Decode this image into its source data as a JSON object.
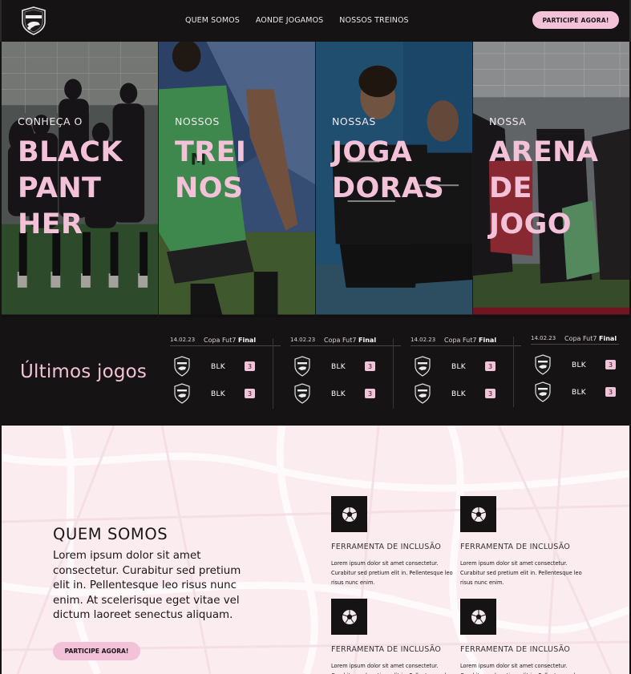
{
  "header": {
    "logo_text": "PANTHER",
    "nav": [
      "QUEM SOMOS",
      "AONDE JOGAMOS",
      "NOSSOS TREINOS"
    ],
    "cta_label": "PARTICIPE AGORA!"
  },
  "hero": {
    "panels": [
      {
        "subtitle": "CONHEÇA O",
        "title_lines": [
          "BLACK",
          "PANT",
          "HER"
        ]
      },
      {
        "subtitle": "NOSSOS",
        "title_lines": [
          "TREI",
          "NOS"
        ]
      },
      {
        "subtitle": "NOSSAS",
        "title_lines": [
          "JOGA",
          "DORAS"
        ]
      },
      {
        "subtitle": "NOSSA",
        "title_lines": [
          "ARENA",
          "DE",
          "JOGO"
        ]
      }
    ]
  },
  "games": {
    "title": "Últimos jogos",
    "cards": [
      {
        "date": "14.02.23",
        "competition": "Copa Fut7",
        "stage": "Final",
        "rows": [
          {
            "team": "BLK",
            "score": "3"
          },
          {
            "team": "BLK",
            "score": "3"
          }
        ]
      },
      {
        "date": "14.02.23",
        "competition": "Copa Fut7",
        "stage": "Final",
        "rows": [
          {
            "team": "BLK",
            "score": "3"
          },
          {
            "team": "BLK",
            "score": "3"
          }
        ]
      },
      {
        "date": "14.02.23",
        "competition": "Copa Fut7",
        "stage": "Final",
        "rows": [
          {
            "team": "BLK",
            "score": "3"
          },
          {
            "team": "BLK",
            "score": "3"
          }
        ]
      },
      {
        "date": "14.02.23",
        "competition": "Copa Fut7",
        "stage": "Final",
        "rows": [
          {
            "team": "BLK",
            "score": "3"
          },
          {
            "team": "BLK",
            "score": "3"
          }
        ]
      }
    ]
  },
  "about": {
    "title": "QUEM SOMOS",
    "body": "Lorem ipsum dolor sit amet consectetur. Curabitur sed pretium elit in. Pellentesque leo risus nunc enim. At scelerisque eget vitae vel dictum laoreet senectus aliquam.",
    "cta_label": "PARTICIPE AGORA!",
    "features": [
      {
        "title": "FERRAMENTA DE INCLUSÃO",
        "text": "Lorem ipsum dolor sit amet consectetur. Curabitur sed pretium elit in. Pellentesque leo risus nunc enim.",
        "icon": "soccer-ball-icon"
      },
      {
        "title": "FERRAMENTA DE INCLUSÃO",
        "text": "Lorem ipsum dolor sit amet consectetur. Curabitur sed pretium elit in. Pellentesque leo risus nunc enim.",
        "icon": "soccer-ball-icon"
      },
      {
        "title": "FERRAMENTA DE INCLUSÃO",
        "text": "Lorem ipsum dolor sit amet consectetur. Curabitur sed pretium elit in. Pellentesque leo risus nunc enim.",
        "icon": "soccer-ball-icon"
      },
      {
        "title": "FERRAMENTA DE INCLUSÃO",
        "text": "Lorem ipsum dolor sit amet consectetur. Curabitur sed pretium elit in. Pellentesque leo risus nunc enim.",
        "icon": "soccer-ball-icon"
      }
    ]
  },
  "colors": {
    "dark": "#151314",
    "accent_pink": "#f3c2d8",
    "light_bg": "#fbecef",
    "jersey_green": "#5fca72"
  }
}
